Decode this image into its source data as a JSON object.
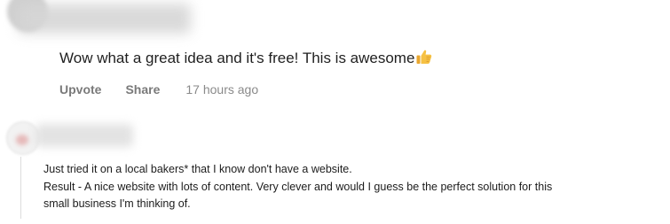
{
  "comment1": {
    "text": "Wow what a great idea and it's free! This is awesome",
    "emoji_icon": "thumbs-up-icon",
    "upvote_label": "Upvote",
    "share_label": "Share",
    "timestamp": "17 hours ago"
  },
  "comment2": {
    "lines": [
      "Just tried it on a local bakers* that I know don't have a website.",
      "Result - A nice website with lots of content. Very clever and would I guess be the perfect solution for this",
      "small business I'm thinking of."
    ]
  },
  "colors": {
    "text_primary": "#1f1f1f",
    "action_gray": "#7a7a7a",
    "timestamp_gray": "#8a8a8a",
    "thread_line": "#dcdcdc",
    "thumb_yellow": "#f2b63d"
  }
}
